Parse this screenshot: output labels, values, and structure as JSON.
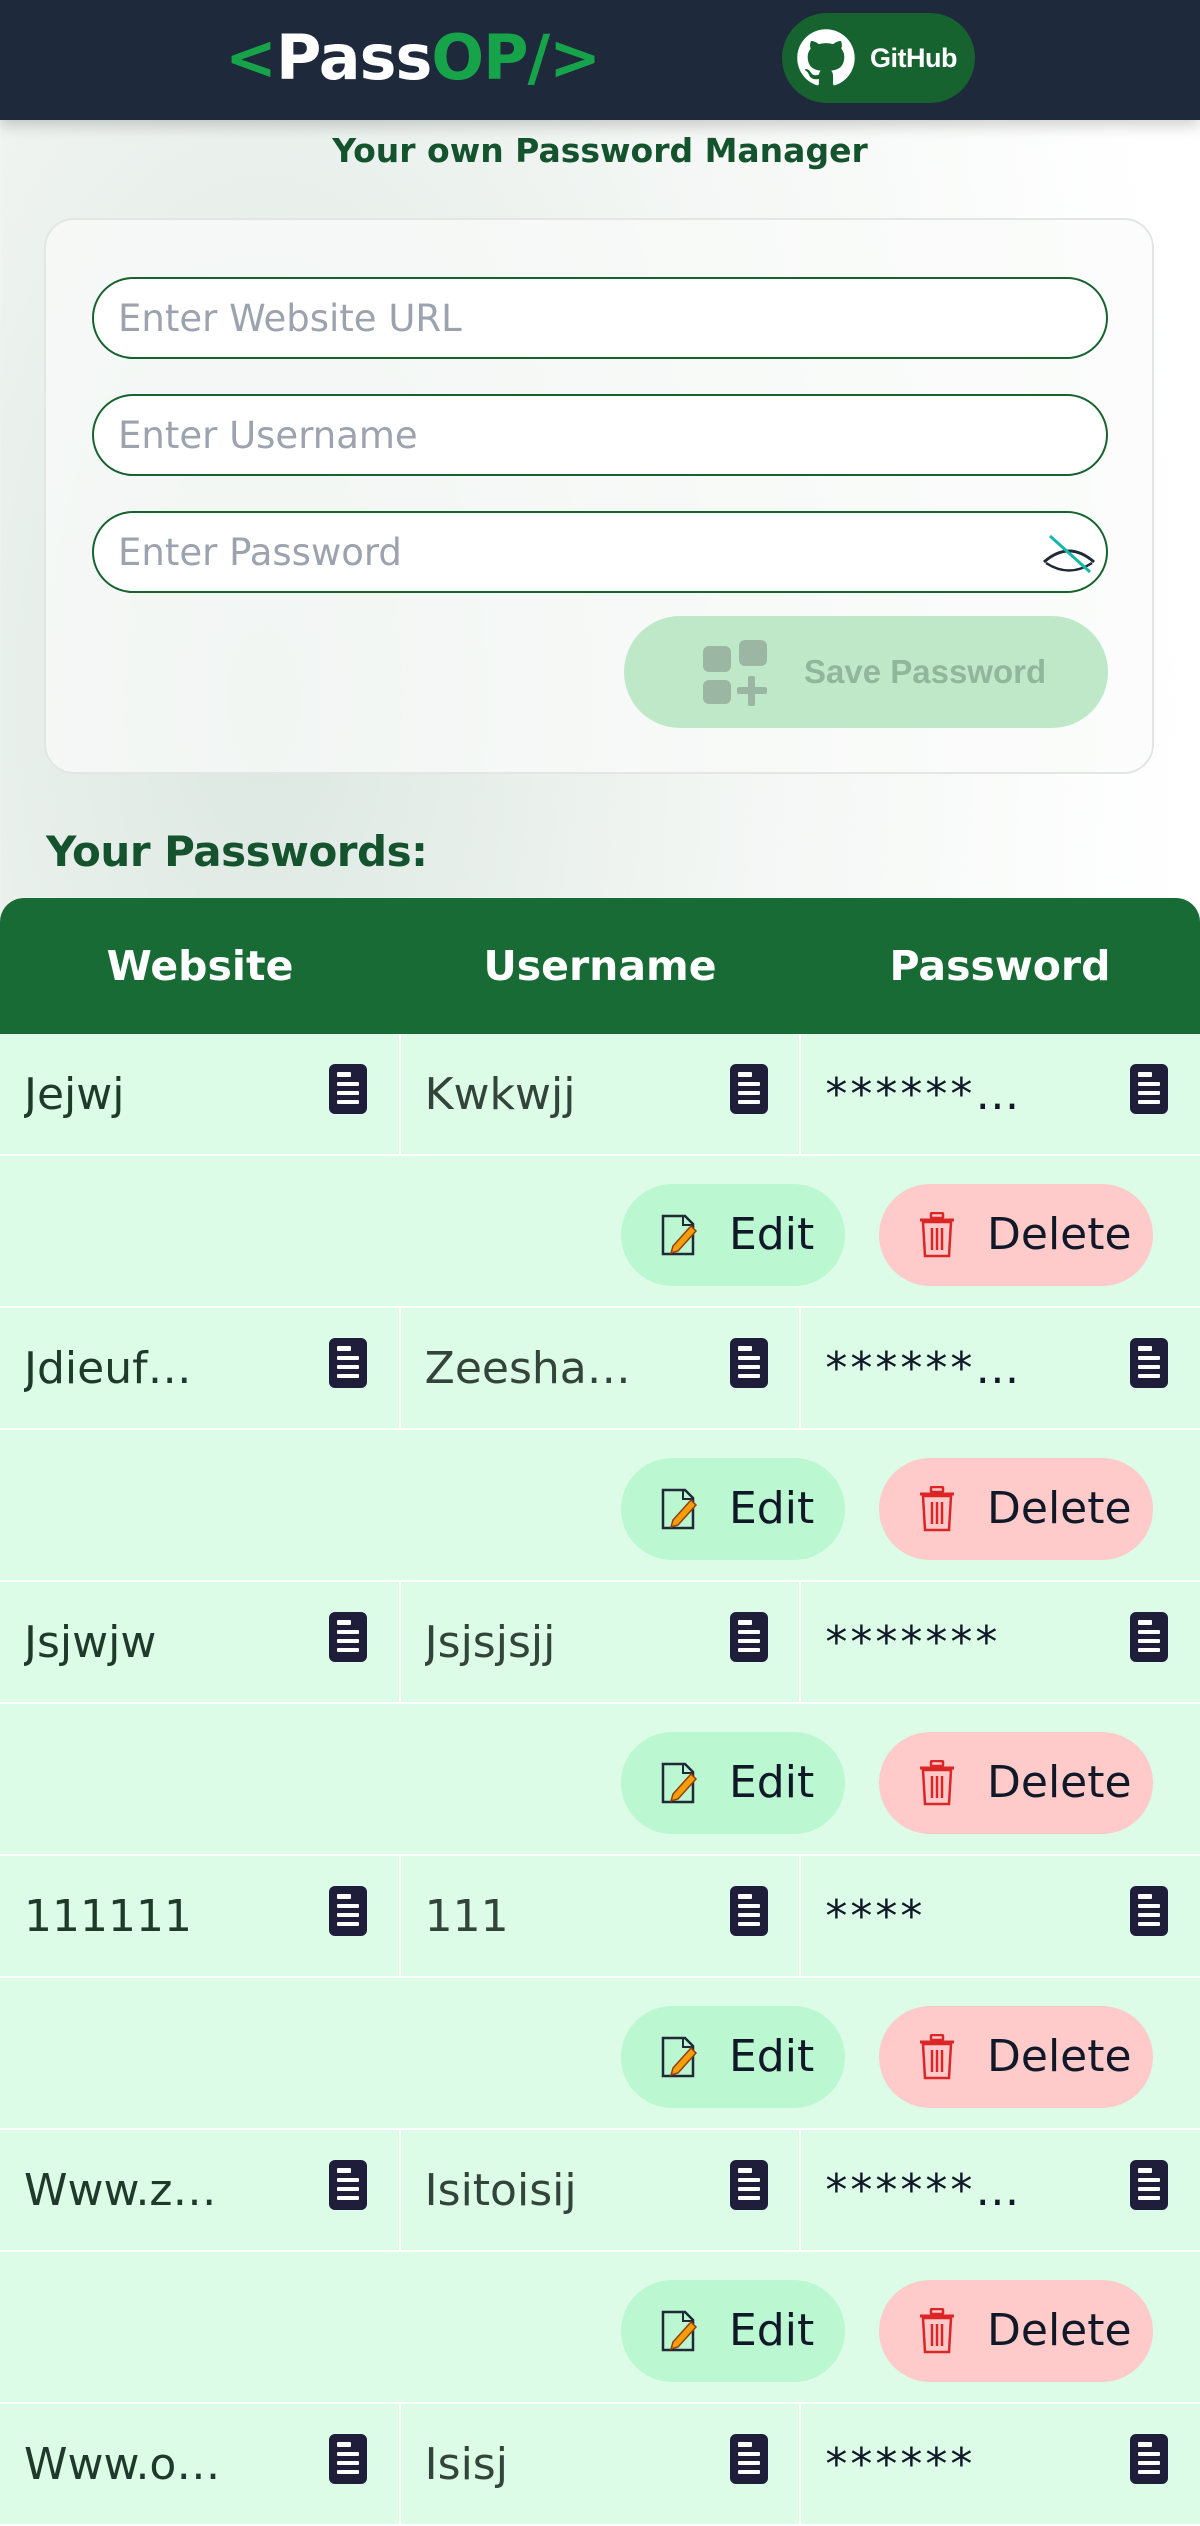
{
  "navbar": {
    "logo_open": "<",
    "logo_pass": "Pass",
    "logo_op": "OP/>",
    "github_label": "GitHub"
  },
  "subtitle": "Your own Password Manager",
  "form": {
    "url_placeholder": "Enter Website URL",
    "username_placeholder": "Enter Username",
    "password_placeholder": "Enter Password",
    "save_label": "Save Password"
  },
  "list": {
    "title": "Your Passwords:",
    "headers": [
      "Website",
      "Username",
      "Password"
    ],
    "edit_label": "Edit",
    "delete_label": "Delete",
    "rows": [
      {
        "website": "Jejwj",
        "username": "Kwkwjj",
        "password": "******…"
      },
      {
        "website": "Jdieuf…",
        "username": "Zeesha…",
        "password": "******…"
      },
      {
        "website": "Jsjwjw",
        "username": "Jsjsjsjj",
        "password": "*******"
      },
      {
        "website": "111111",
        "username": "111",
        "password": "****"
      },
      {
        "website": "Www.z…",
        "username": "Isitoisij",
        "password": "******…"
      },
      {
        "website": "Www.o…",
        "username": "Isisj",
        "password": "******"
      }
    ]
  },
  "icons": {
    "github": "github-icon",
    "eye": "eye-hidden-icon",
    "save": "add-item-icon",
    "copy": "copy-icon",
    "edit": "edit-icon",
    "delete": "trash-icon"
  },
  "colors": {
    "navbar": "#1e293b",
    "brand_green": "#16a34a",
    "header_green": "#196b35",
    "row_bg": "#dcfce7",
    "edit_bg": "#bbf7d0",
    "delete_bg": "#fecaca"
  }
}
